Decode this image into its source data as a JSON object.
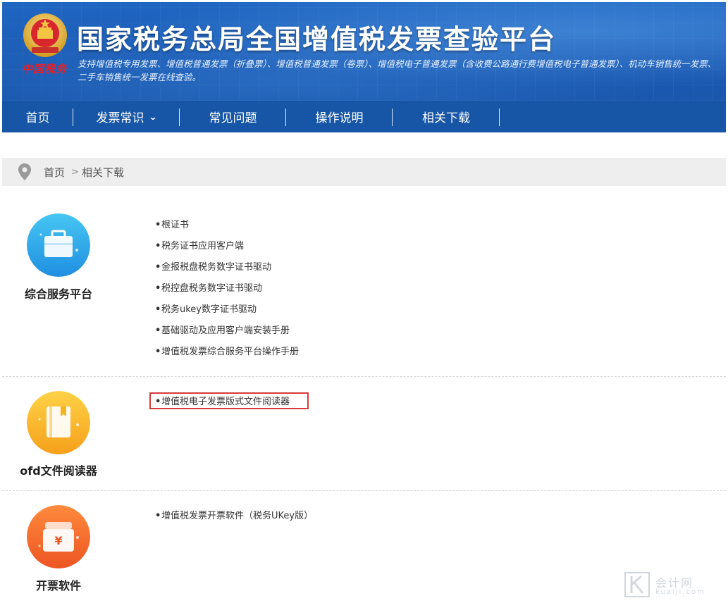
{
  "header": {
    "emblem_text": "中国税务",
    "title": "国家税务总局全国增值税发票查验平台",
    "subtitle": "支持增值税专用发票、增值税普通发票（折叠票）、增值税普通发票（卷票）、增值税电子普通发票（含收费公路通行费增值税电子普通发票）、机动车销售统一发票、二手车销售统一发票在线查验。"
  },
  "nav": {
    "items": [
      {
        "label": "首页"
      },
      {
        "label": "发票常识",
        "has_dropdown": true,
        "dropdown_icon": "chevron-down-icon"
      },
      {
        "label": "常见问题"
      },
      {
        "label": "操作说明"
      },
      {
        "label": "相关下载"
      }
    ]
  },
  "breadcrumb": {
    "icon": "location-pin-icon",
    "home": "首页",
    "separator": ">",
    "current": "相关下载"
  },
  "sections": [
    {
      "label": "综合服务平台",
      "icon": "briefcase-icon",
      "color": "#2aa6e8",
      "links": [
        "根证书",
        "税务证书应用客户端",
        "金报税盘税务数字证书驱动",
        "税控盘税务数字证书驱动",
        "税务ukey数字证书驱动",
        "基础驱动及应用客户端安装手册",
        "增值税发票综合服务平台操作手册"
      ]
    },
    {
      "label": "ofd文件阅读器",
      "icon": "book-icon",
      "color": "#f7b21f",
      "links": [
        "增值税电子发票版式文件阅读器"
      ],
      "highlighted": "增值税电子发票版式文件阅读器",
      "highlight_color": "#d83a3a"
    },
    {
      "label": "开票软件",
      "icon": "invoice-box-icon",
      "color": "#f06a2c",
      "links": [
        "增值税发票开票软件（税务UKey版）"
      ]
    }
  ],
  "watermark": {
    "name": "会计网",
    "url": "kuaiji.com"
  },
  "colors": {
    "header_blue": "#1c5cb5",
    "nav_blue": "#1756a6",
    "breadcrumb_bg": "#eeeeee"
  }
}
